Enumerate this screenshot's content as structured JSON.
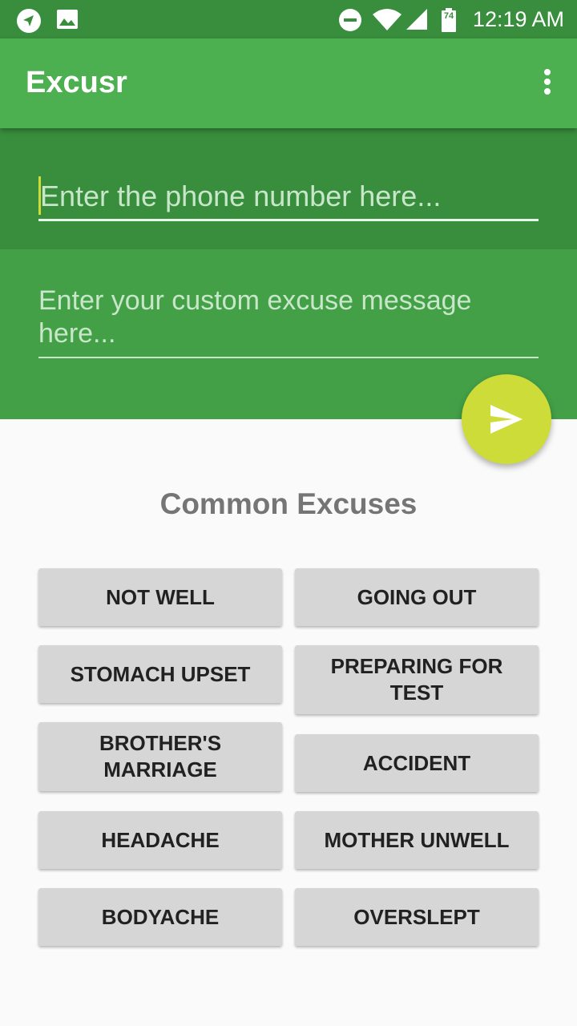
{
  "status_bar": {
    "time": "12:19 AM",
    "battery_level": "74",
    "icons": [
      "navigation-icon",
      "image-icon",
      "do-not-disturb-icon",
      "wifi-icon",
      "signal-icon",
      "battery-icon"
    ]
  },
  "app_bar": {
    "title": "Excusr",
    "menu_icon": "more-vert-icon"
  },
  "form": {
    "phone_placeholder": "Enter the phone number here...",
    "phone_value": "",
    "message_placeholder": "Enter your custom excuse message here...",
    "message_value": "",
    "send_icon": "send-icon"
  },
  "excuses": {
    "title": "Common Excuses",
    "buttons": [
      "NOT WELL",
      "GOING OUT",
      "STOMACH UPSET",
      "PREPARING FOR TEST",
      "BROTHER'S MARRIAGE",
      "ACCIDENT",
      "HEADACHE",
      "MOTHER UNWELL",
      "BODYACHE",
      "OVERSLEPT"
    ]
  },
  "colors": {
    "status_bar": "#388e3c",
    "app_bar": "#4caf50",
    "phone_section": "#388e3c",
    "message_section": "#43a047",
    "fab": "#cddc39",
    "button_bg": "#d6d6d6"
  }
}
